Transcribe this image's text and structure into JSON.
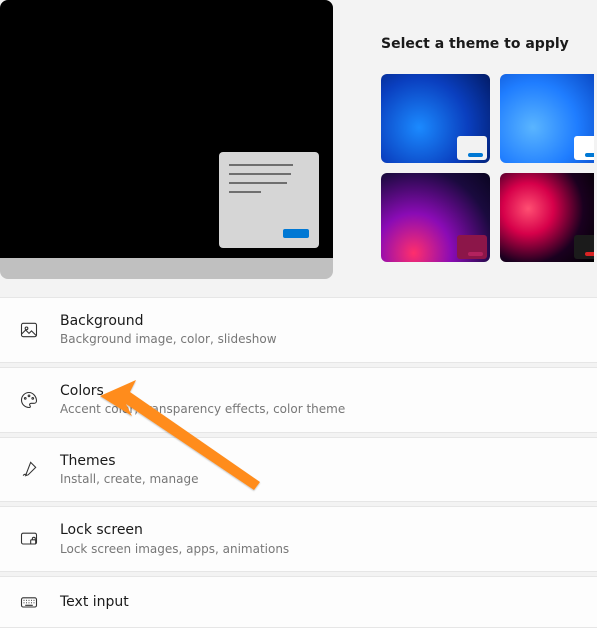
{
  "themes": {
    "heading": "Select a theme to apply"
  },
  "rows": {
    "background": {
      "title": "Background",
      "sub": "Background image, color, slideshow"
    },
    "colors": {
      "title": "Colors",
      "sub": "Accent color, transparency effects, color theme"
    },
    "themes": {
      "title": "Themes",
      "sub": "Install, create, manage"
    },
    "lockscreen": {
      "title": "Lock screen",
      "sub": "Lock screen images, apps, animations"
    },
    "textinput": {
      "title": "Text input",
      "sub": ""
    }
  }
}
